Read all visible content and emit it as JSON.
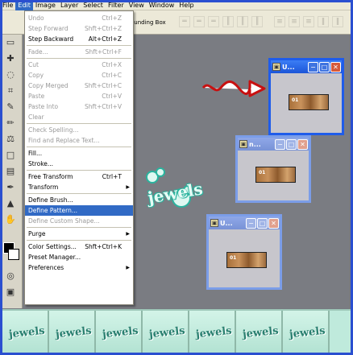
{
  "menubar": [
    "File",
    "Edit",
    "Image",
    "Layer",
    "Select",
    "Filter",
    "View",
    "Window",
    "Help"
  ],
  "options_bar": {
    "bounding_box_label": "ounding Box"
  },
  "edit_menu": {
    "items": [
      {
        "label": "Undo",
        "shortcut": "Ctrl+Z",
        "disabled": true
      },
      {
        "label": "Step Forward",
        "shortcut": "Shft+Ctrl+Z",
        "disabled": true
      },
      {
        "label": "Step Backward",
        "shortcut": "Alt+Ctrl+Z",
        "disabled": false
      },
      {
        "sep": true
      },
      {
        "label": "Fade...",
        "shortcut": "Shft+Ctrl+F",
        "disabled": true
      },
      {
        "sep": true
      },
      {
        "label": "Cut",
        "shortcut": "Ctrl+X",
        "disabled": true
      },
      {
        "label": "Copy",
        "shortcut": "Ctrl+C",
        "disabled": true
      },
      {
        "label": "Copy Merged",
        "shortcut": "Shft+Ctrl+C",
        "disabled": true
      },
      {
        "label": "Paste",
        "shortcut": "Ctrl+V",
        "disabled": true
      },
      {
        "label": "Paste Into",
        "shortcut": "Shft+Ctrl+V",
        "disabled": true
      },
      {
        "label": "Clear",
        "shortcut": "",
        "disabled": true
      },
      {
        "sep": true
      },
      {
        "label": "Check Spelling...",
        "shortcut": "",
        "disabled": true
      },
      {
        "label": "Find and Replace Text...",
        "shortcut": "",
        "disabled": true
      },
      {
        "sep": true
      },
      {
        "label": "Fill...",
        "shortcut": "",
        "disabled": false
      },
      {
        "label": "Stroke...",
        "shortcut": "",
        "disabled": false
      },
      {
        "sep": true
      },
      {
        "label": "Free Transform",
        "shortcut": "Ctrl+T",
        "disabled": false
      },
      {
        "label": "Transform",
        "shortcut": "",
        "disabled": false,
        "submenu": true
      },
      {
        "sep": true
      },
      {
        "label": "Define Brush...",
        "shortcut": "",
        "disabled": false
      },
      {
        "label": "Define Pattern...",
        "shortcut": "",
        "disabled": false,
        "highlighted": true
      },
      {
        "label": "Define Custom Shape...",
        "shortcut": "",
        "disabled": true
      },
      {
        "sep": true
      },
      {
        "label": "Purge",
        "shortcut": "",
        "disabled": false,
        "submenu": true
      },
      {
        "sep": true
      },
      {
        "label": "Color Settings...",
        "shortcut": "Shft+Ctrl+K",
        "disabled": false
      },
      {
        "label": "Preset Manager...",
        "shortcut": "",
        "disabled": false
      },
      {
        "label": "Preferences",
        "shortcut": "",
        "disabled": false,
        "submenu": true
      }
    ]
  },
  "windows": [
    {
      "title": "U...",
      "image_label": "01"
    },
    {
      "title": "n...",
      "image_label": "01"
    },
    {
      "title": "U...",
      "image_label": "01"
    }
  ],
  "logo_text": "jewels",
  "tile_text": "jewels",
  "tile_count": 7,
  "colors": {
    "accent": "#316ac5",
    "title_active": "#1c55d8",
    "workspace": "#7a7c82",
    "tile_bg": "#bfeadc"
  }
}
